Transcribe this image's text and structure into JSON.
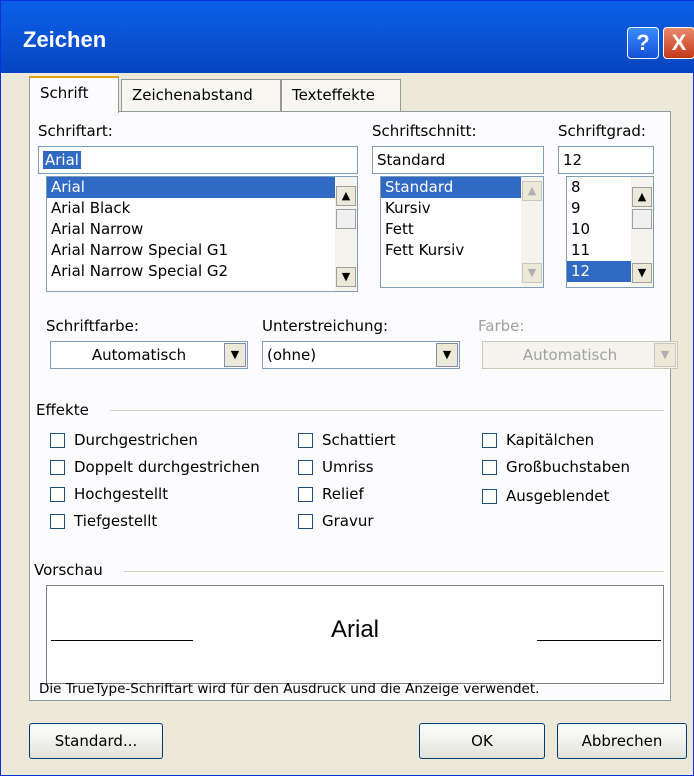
{
  "window": {
    "title": "Zeichen"
  },
  "titlebar": {
    "help": "?",
    "close": "X"
  },
  "tabs": [
    {
      "label": "Schrift"
    },
    {
      "label": "Zeichenabstand"
    },
    {
      "label": "Texteffekte"
    }
  ],
  "font": {
    "label": "Schriftart:",
    "value": "Arial",
    "items": [
      "Arial",
      "Arial Black",
      "Arial Narrow",
      "Arial Narrow Special G1",
      "Arial Narrow Special G2"
    ],
    "selected_index": 0
  },
  "style": {
    "label": "Schriftschnitt:",
    "value": "Standard",
    "items": [
      "Standard",
      "Kursiv",
      "Fett",
      "Fett Kursiv"
    ],
    "selected_index": 0
  },
  "size": {
    "label": "Schriftgrad:",
    "value": "12",
    "items": [
      "8",
      "9",
      "10",
      "11",
      "12"
    ],
    "selected_index": 4
  },
  "color": {
    "label": "Schriftfarbe:",
    "value": "Automatisch"
  },
  "underline": {
    "label": "Unterstreichung:",
    "value": "(ohne)"
  },
  "underline_color": {
    "label": "Farbe:",
    "value": "Automatisch"
  },
  "effects": {
    "title": "Effekte",
    "col1": [
      "Durchgestrichen",
      "Doppelt durchgestrichen",
      "Hochgestellt",
      "Tiefgestellt"
    ],
    "col2": [
      "Schattiert",
      "Umriss",
      "Relief",
      "Gravur"
    ],
    "col3": [
      "Kapitälchen",
      "Großbuchstaben",
      "Ausgeblendet"
    ]
  },
  "preview": {
    "title": "Vorschau",
    "sample": "Arial",
    "note": "Die TrueType-Schriftart wird für den Ausdruck und die Anzeige verwendet."
  },
  "buttons": {
    "default": "Standard...",
    "ok": "OK",
    "cancel": "Abbrechen"
  },
  "colors": {
    "titlebar": "#0a56d8",
    "selection": "#316ac5",
    "tab_accent": "#e6a216"
  }
}
